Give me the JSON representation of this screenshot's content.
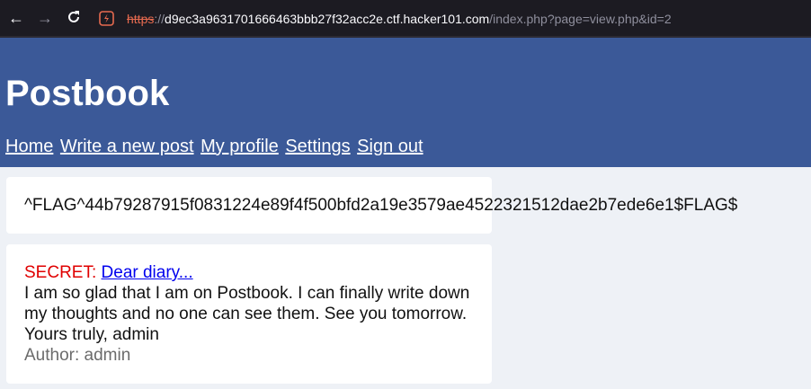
{
  "browser": {
    "url_scheme": "https",
    "url_separator": "://",
    "url_host": "d9ec3a9631701666463bbb27f32acc2e.ctf.hacker101.com",
    "url_path": "/index.php?page=view.php&id=2"
  },
  "site": {
    "title": "Postbook",
    "nav": [
      "Home",
      "Write a new post",
      "My profile",
      "Settings",
      "Sign out"
    ]
  },
  "flag": "^FLAG^44b79287915f0831224e89f4f500bfd2a19e3579ae4522321512dae2b7ede6e1$FLAG$",
  "post": {
    "secret_label": "SECRET:",
    "title": "Dear diary...",
    "body": "I am so glad that I am on Postbook. I can finally write down my thoughts and no one can see them. See you tomorrow. Yours truly, admin",
    "author_label": "Author:",
    "author": "admin"
  },
  "colors": {
    "header": "#3b5998",
    "secret": "#e00000",
    "link": "#0000ee",
    "page_bg": "#eef1f6"
  }
}
